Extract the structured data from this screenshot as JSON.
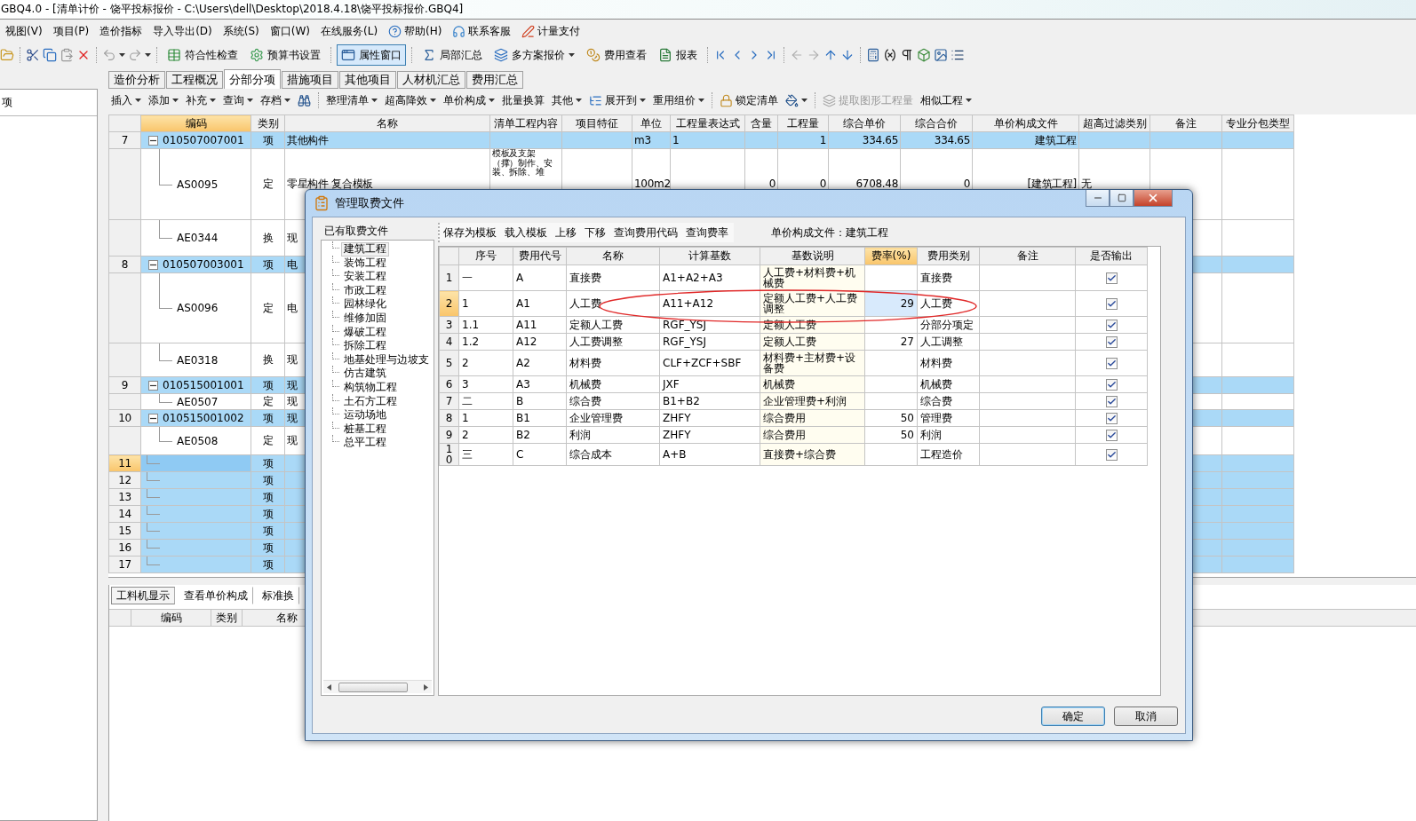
{
  "window": {
    "title": "GBQ4.0 - [清单计价 - 饶平投标报价 - C:\\Users\\dell\\Desktop\\2018.4.18\\饶平投标报价.GBQ4]"
  },
  "menu": [
    {
      "label": "视图(V)"
    },
    {
      "label": "项目(P)"
    },
    {
      "label": "造价指标"
    },
    {
      "label": "导入导出(D)"
    },
    {
      "label": "系统(S)"
    },
    {
      "label": "窗口(W)"
    },
    {
      "label": "在线服务(L)"
    },
    {
      "label": "帮助(H)"
    },
    {
      "label": "联系客服"
    },
    {
      "label": "计量支付"
    }
  ],
  "toolbar": [
    {
      "label": "符合性检查",
      "selected": false,
      "dropdown": false
    },
    {
      "label": "预算书设置",
      "selected": false,
      "dropdown": false
    },
    {
      "label": "属性窗口",
      "selected": true,
      "dropdown": false
    },
    {
      "label": "局部汇总",
      "selected": false,
      "dropdown": false
    },
    {
      "label": "多方案报价",
      "selected": false,
      "dropdown": true
    },
    {
      "label": "费用查看",
      "selected": false,
      "dropdown": false
    },
    {
      "label": "报表",
      "selected": false,
      "dropdown": false
    }
  ],
  "left_pane": {
    "header": "项"
  },
  "tabs": [
    {
      "label": "造价分析",
      "selected": false
    },
    {
      "label": "工程概况",
      "selected": false
    },
    {
      "label": "分部分项",
      "selected": true
    },
    {
      "label": "措施项目",
      "selected": false
    },
    {
      "label": "其他项目",
      "selected": false
    },
    {
      "label": "人材机汇总",
      "selected": false
    },
    {
      "label": "费用汇总",
      "selected": false
    }
  ],
  "sub_toolbar": [
    {
      "kind": "text",
      "label": "插入",
      "dropdown": true,
      "disabled": false
    },
    {
      "kind": "text",
      "label": "添加",
      "dropdown": true,
      "disabled": false
    },
    {
      "kind": "text",
      "label": "补充",
      "dropdown": true,
      "disabled": false
    },
    {
      "kind": "text",
      "label": "查询",
      "dropdown": true,
      "disabled": false
    },
    {
      "kind": "text",
      "label": "存档",
      "dropdown": true,
      "disabled": false
    },
    {
      "kind": "icon",
      "dropdown": false,
      "disabled": false
    },
    {
      "kind": "text",
      "label": "整理清单",
      "dropdown": true,
      "disabled": false
    },
    {
      "kind": "text",
      "label": "超高降效",
      "dropdown": true,
      "disabled": false
    },
    {
      "kind": "text",
      "label": "单价构成",
      "dropdown": true,
      "disabled": false
    },
    {
      "kind": "text",
      "label": "批量换算",
      "dropdown": false,
      "disabled": false
    },
    {
      "kind": "text",
      "label": "其他",
      "dropdown": true,
      "disabled": false
    },
    {
      "kind": "text",
      "label": "展开到",
      "dropdown": true,
      "disabled": false
    },
    {
      "kind": "text",
      "label": "重用组价",
      "dropdown": true,
      "disabled": false
    },
    {
      "kind": "text",
      "label": "锁定清单",
      "dropdown": false,
      "disabled": false
    },
    {
      "kind": "icon",
      "dropdown": true,
      "disabled": false
    },
    {
      "kind": "text",
      "label": "提取图形工程量",
      "dropdown": false,
      "disabled": true
    },
    {
      "kind": "text",
      "label": "相似工程",
      "dropdown": true,
      "disabled": false
    }
  ],
  "table": {
    "columns": [
      {
        "label": "编码",
        "selected": true
      },
      {
        "label": "类别",
        "selected": false
      },
      {
        "label": "名称",
        "selected": false
      },
      {
        "label": "清单工程内容",
        "selected": false
      },
      {
        "label": "项目特征",
        "selected": false
      },
      {
        "label": "单位",
        "selected": false
      },
      {
        "label": "工程量表达式",
        "selected": false
      },
      {
        "label": "含量",
        "selected": false
      },
      {
        "label": "工程量",
        "selected": false
      },
      {
        "label": "综合单价",
        "selected": false
      },
      {
        "label": "综合合价",
        "selected": false
      },
      {
        "label": "单价构成文件",
        "selected": false
      },
      {
        "label": "超高过滤类别",
        "selected": false
      },
      {
        "label": "备注",
        "selected": false
      },
      {
        "label": "专业分包类型",
        "selected": false
      }
    ],
    "rows": [
      {
        "num": "7",
        "kind": "list",
        "selected": false,
        "expanded": true,
        "code": "010507007001",
        "type": "项",
        "name": "其他构件",
        "unit": "m3",
        "expr": "1",
        "qty": "1",
        "price": "334.65",
        "total": "334.65",
        "file": "建筑工程"
      },
      {
        "kind": "quota",
        "selected": false,
        "code": "AS0095",
        "type": "定",
        "name": "零星构件 复合模板",
        "content": "模板及支架（撑）制作、安装、拆除、堆",
        "unit": "100m2",
        "ratio": "0",
        "qty": "0",
        "price": "6708.48",
        "total": "0",
        "file": "[建筑工程]",
        "filter": "无"
      },
      {
        "kind": "quota",
        "selected": false,
        "code": "AE0344",
        "type": "换",
        "name": "现"
      },
      {
        "num": "8",
        "kind": "list",
        "selected": false,
        "expanded": true,
        "code": "010507003001",
        "type": "项",
        "name": "电"
      },
      {
        "kind": "quota",
        "selected": false,
        "code": "AS0096",
        "type": "定",
        "name": "电"
      },
      {
        "kind": "quota",
        "selected": false,
        "code": "AE0318",
        "type": "换",
        "name": "现"
      },
      {
        "num": "9",
        "kind": "list",
        "selected": false,
        "expanded": true,
        "code": "010515001001",
        "type": "项",
        "name": "现"
      },
      {
        "kind": "quota",
        "selected": false,
        "code": "AE0507",
        "type": "定",
        "name": "现"
      },
      {
        "num": "10",
        "kind": "list",
        "selected": false,
        "expanded": true,
        "code": "010515001002",
        "type": "项",
        "name": "现"
      },
      {
        "kind": "quota",
        "selected": false,
        "code": "AE0508",
        "type": "定",
        "name": "现"
      },
      {
        "num": "11",
        "kind": "list",
        "selected": true,
        "type": "项"
      },
      {
        "num": "12",
        "kind": "list",
        "selected": false,
        "type": "项"
      },
      {
        "num": "13",
        "kind": "list",
        "selected": false,
        "type": "项"
      },
      {
        "num": "14",
        "kind": "list",
        "selected": false,
        "type": "项"
      },
      {
        "num": "15",
        "kind": "list",
        "selected": false,
        "type": "项"
      },
      {
        "num": "16",
        "kind": "list",
        "selected": false,
        "type": "项"
      },
      {
        "num": "17",
        "kind": "list",
        "selected": false,
        "type": "项"
      }
    ]
  },
  "bottom_panel": {
    "tabs": [
      {
        "label": "工料机显示",
        "selected": true
      },
      {
        "label": "查看单价构成",
        "selected": false
      },
      {
        "label": "标准换",
        "selected": false
      }
    ],
    "columns": [
      "编码",
      "类别",
      "名称"
    ]
  },
  "dialog": {
    "title": "管理取费文件",
    "files_header": "已有取费文件",
    "files": [
      {
        "label": "建筑工程",
        "selected": true
      },
      {
        "label": "装饰工程",
        "selected": false
      },
      {
        "label": "安装工程",
        "selected": false
      },
      {
        "label": "市政工程",
        "selected": false
      },
      {
        "label": "园林绿化",
        "selected": false
      },
      {
        "label": "维修加固",
        "selected": false
      },
      {
        "label": "爆破工程",
        "selected": false
      },
      {
        "label": "拆除工程",
        "selected": false
      },
      {
        "label": "地基处理与边坡支",
        "selected": false
      },
      {
        "label": "仿古建筑",
        "selected": false
      },
      {
        "label": "构筑物工程",
        "selected": false
      },
      {
        "label": "土石方工程",
        "selected": false
      },
      {
        "label": "运动场地",
        "selected": false
      },
      {
        "label": "桩基工程",
        "selected": false
      },
      {
        "label": "总平工程",
        "selected": false
      }
    ],
    "toolbar": [
      "保存为模板",
      "载入模板",
      "上移",
      "下移",
      "查询费用代码",
      "查询费率"
    ],
    "current_file": "单价构成文件：建筑工程",
    "columns": [
      {
        "label": "序号",
        "selected": false
      },
      {
        "label": "费用代号",
        "selected": false
      },
      {
        "label": "名称",
        "selected": false
      },
      {
        "label": "计算基数",
        "selected": false
      },
      {
        "label": "基数说明",
        "selected": false
      },
      {
        "label": "费率(%)",
        "selected": true
      },
      {
        "label": "费用类别",
        "selected": false
      },
      {
        "label": "备注",
        "selected": false
      },
      {
        "label": "是否输出",
        "selected": false
      }
    ],
    "rows": [
      {
        "num": "1",
        "seq": "一",
        "code": "A",
        "name": "直接费",
        "base": "A1+A2+A3",
        "base_desc": "人工费+材料费+机械费",
        "category": "直接费",
        "output": true,
        "selected": false
      },
      {
        "num": "2",
        "seq": "1",
        "code": "A1",
        "name": "人工费",
        "base": "A11+A12",
        "base_desc": "定额人工费+人工费调整",
        "rate": "29",
        "category": "人工费",
        "output": true,
        "selected": true
      },
      {
        "num": "3",
        "seq": "1.1",
        "code": "A11",
        "name": "定额人工费",
        "base": "RGF_YSJ",
        "base_desc": "定额人工费",
        "category": "分部分项定",
        "output": true,
        "selected": false
      },
      {
        "num": "4",
        "seq": "1.2",
        "code": "A12",
        "name": "人工费调整",
        "base": "RGF_YSJ",
        "base_desc": "定额人工费",
        "rate": "27",
        "category": "人工调整",
        "output": true,
        "selected": false
      },
      {
        "num": "5",
        "seq": "2",
        "code": "A2",
        "name": "材料费",
        "base": "CLF+ZCF+SBF",
        "base_desc": "材料费+主材费+设备费",
        "category": "材料费",
        "output": true,
        "selected": false
      },
      {
        "num": "6",
        "seq": "3",
        "code": "A3",
        "name": "机械费",
        "base": "JXF",
        "base_desc": "机械费",
        "category": "机械费",
        "output": true,
        "selected": false
      },
      {
        "num": "7",
        "seq": "二",
        "code": "B",
        "name": "综合费",
        "base": "B1+B2",
        "base_desc": "企业管理费+利润",
        "category": "综合费",
        "output": true,
        "selected": false
      },
      {
        "num": "8",
        "seq": "1",
        "code": "B1",
        "name": "企业管理费",
        "base": "ZHFY",
        "base_desc": "综合费用",
        "rate": "50",
        "category": "管理费",
        "output": true,
        "selected": false
      },
      {
        "num": "9",
        "seq": "2",
        "code": "B2",
        "name": "利润",
        "base": "ZHFY",
        "base_desc": "综合费用",
        "rate": "50",
        "category": "利润",
        "output": true,
        "selected": false
      },
      {
        "num": "10",
        "seq": "三",
        "code": "C",
        "name": "综合成本",
        "base": "A+B",
        "base_desc": "直接费+综合费",
        "category": "工程造价",
        "output": true,
        "selected": false
      }
    ],
    "buttons": [
      {
        "label": "确定",
        "focused": true
      },
      {
        "label": "取消",
        "focused": false
      }
    ]
  }
}
